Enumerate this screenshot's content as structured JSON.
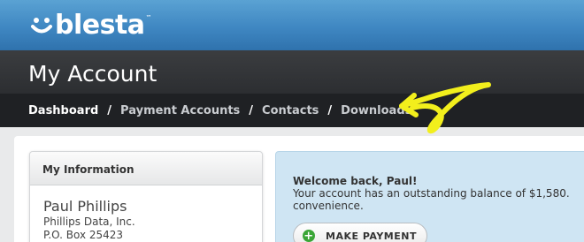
{
  "brand": {
    "logo_text": "blesta",
    "trademark": "™"
  },
  "page": {
    "title": "My Account"
  },
  "nav": {
    "items": [
      {
        "label": "Dashboard",
        "active": true
      },
      {
        "label": "Payment Accounts",
        "active": false
      },
      {
        "label": "Contacts",
        "active": false
      },
      {
        "label": "Downloads",
        "active": false
      }
    ],
    "separator": "/"
  },
  "info_panel": {
    "heading": "My Information",
    "name": "Paul Phillips",
    "company": "Phillips Data, Inc.",
    "address": "P.O. Box 25423"
  },
  "welcome": {
    "title": "Welcome back, Paul!",
    "message_line1": "Your account has an outstanding balance of $1,580.",
    "message_line2": "convenience.",
    "button_label": "MAKE PAYMENT",
    "button_icon": "plus-icon"
  },
  "colors": {
    "header_blue": "#3f87c2",
    "title_bar": "#2c2e31",
    "nav_bar": "#1f2124",
    "welcome_bg": "#cfe5f3",
    "annotation_arrow": "#f2ef1c",
    "payment_icon": "#3aa536"
  }
}
